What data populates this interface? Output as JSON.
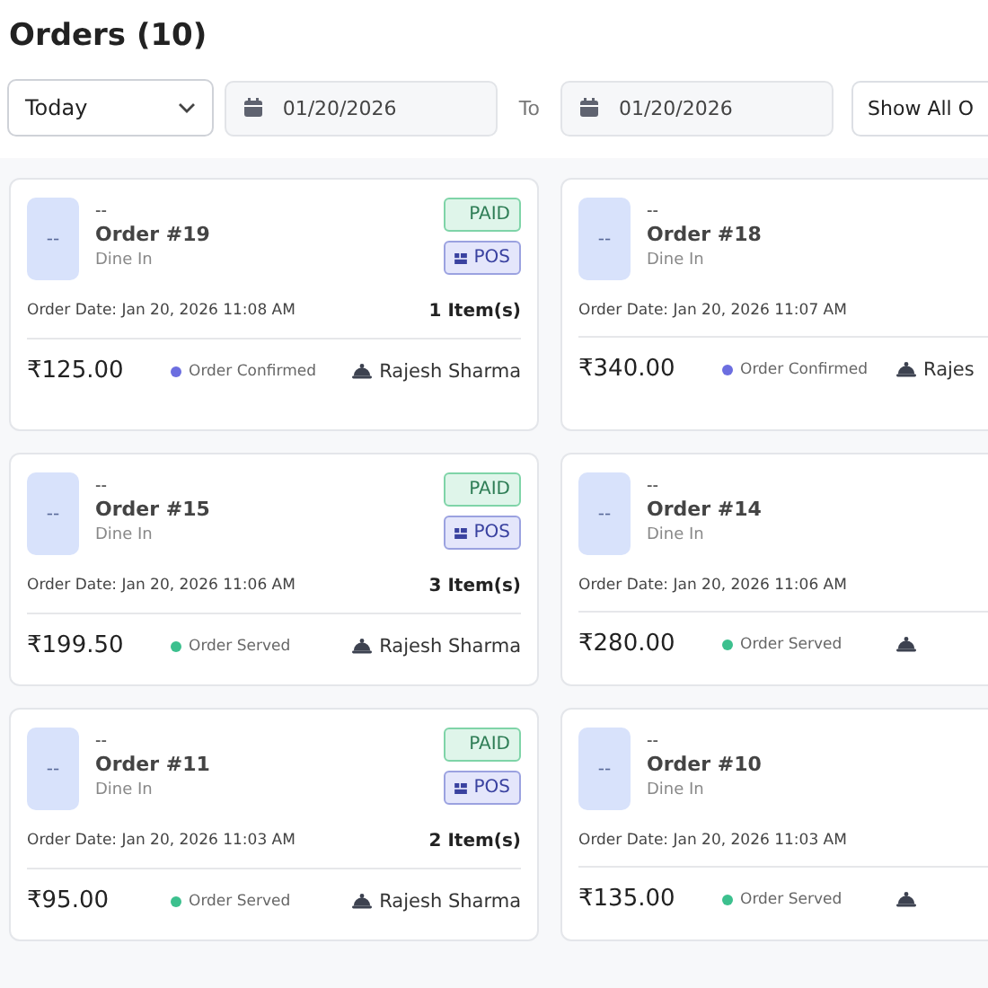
{
  "title": "Orders (10)",
  "filters": {
    "range": "Today",
    "from": "01/20/2026",
    "to_label": "To",
    "to": "01/20/2026",
    "status_filter": "Show All O"
  },
  "orders": [
    {
      "avatar": "--",
      "customer": "--",
      "order": "Order #19",
      "type": "Dine In",
      "date_label": "Order Date:",
      "date": "Jan 20, 2026 11:08 AM",
      "items": "1 Item(s)",
      "price": "₹125.00",
      "status": "Order Confirmed",
      "color": "#6c6ee0",
      "server": "Rajesh Sharma",
      "badges": [
        "PAID",
        "POS"
      ]
    },
    {
      "avatar": "--",
      "customer": "--",
      "order": "Order #18",
      "type": "Dine In",
      "date_label": "Order Date:",
      "date": "Jan 20, 2026 11:07 AM",
      "price": "₹340.00",
      "status": "Order Confirmed",
      "color": "#6c6ee0",
      "server": "Rajes"
    },
    {
      "avatar": "--",
      "customer": "--",
      "order": "Order #15",
      "type": "Dine In",
      "date_label": "Order Date:",
      "date": "Jan 20, 2026 11:06 AM",
      "items": "3 Item(s)",
      "price": "₹199.50",
      "status": "Order Served",
      "color": "#3cc08e",
      "server": "Rajesh Sharma",
      "badges": [
        "PAID",
        "POS"
      ]
    },
    {
      "avatar": "--",
      "customer": "--",
      "order": "Order #14",
      "type": "Dine In",
      "date_label": "Order Date:",
      "date": "Jan 20, 2026 11:06 AM",
      "price": "₹280.00",
      "status": "Order Served",
      "color": "#3cc08e"
    },
    {
      "avatar": "--",
      "customer": "--",
      "order": "Order #11",
      "type": "Dine In",
      "date_label": "Order Date:",
      "date": "Jan 20, 2026 11:03 AM",
      "items": "2 Item(s)",
      "price": "₹95.00",
      "status": "Order Served",
      "color": "#3cc08e",
      "server": "Rajesh Sharma",
      "badges": [
        "PAID",
        "POS"
      ]
    },
    {
      "avatar": "--",
      "customer": "--",
      "order": "Order #10",
      "type": "Dine In",
      "date_label": "Order Date:",
      "date": "Jan 20, 2026 11:03 AM",
      "price": "₹135.00",
      "status": "Order Served",
      "color": "#3cc08e"
    }
  ]
}
